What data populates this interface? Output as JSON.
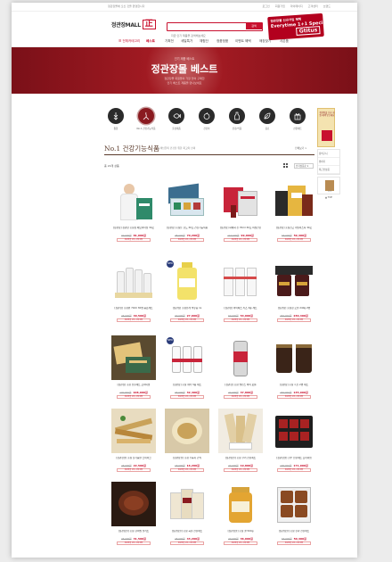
{
  "topbar": {
    "left_text": "정관장몰에 오신 것을 환영합니다",
    "links": [
      "로그인",
      "회원가입",
      "마이페이지",
      "고객센터",
      "브랜드"
    ]
  },
  "header": {
    "logo_text": "정관장MALL",
    "logo_mark": "正",
    "search_placeholder": "지금 인기 제품을 검색해보세요",
    "search_button": "검색",
    "promo_line1": "정관장몰 신규가입 혜택",
    "promo_line2": "Everytime 1+1 Special",
    "promo_badge": "Gtitus"
  },
  "nav": {
    "items": [
      "☰ 전체카테고리",
      "베스트",
      "기획전",
      "세일특가",
      "체험단",
      "정품정품",
      "이벤트 혜택",
      "매장찾기",
      "사은품"
    ]
  },
  "hero": {
    "pre_title": "인기 제품 베스트",
    "title": "정관장몰 베스트",
    "sub1": "정관장몰 회원들이 가장 많이 구매한",
    "sub2": "인기 베스트 제품을 만나보세요"
  },
  "categories": [
    {
      "label": "종합",
      "icon": "ginseng-icon",
      "active": false
    },
    {
      "label": "No.1 건강기능식품",
      "icon": "ginseng-root-icon",
      "active": true
    },
    {
      "label": "홍삼제품",
      "icon": "fish-icon",
      "active": false
    },
    {
      "label": "건강차",
      "icon": "apple-icon",
      "active": false
    },
    {
      "label": "건강/식품",
      "icon": "bottle-icon",
      "active": false
    },
    {
      "label": "음료",
      "icon": "leaf-icon",
      "active": false
    },
    {
      "label": "선물세트",
      "icon": "gift-icon",
      "active": false
    }
  ],
  "side": {
    "ad_text": "정관장몰 신규 회원 혜택 받으세요",
    "links": [
      "장바구니",
      "찜하기",
      "최근본상품"
    ],
    "recent_page": "1/1",
    "top_label": "▲ TOP"
  },
  "section": {
    "title": "No.1 건강기능식품",
    "description": "고객님들의 건강을 위한 최고의 선택",
    "more": "전체보기 >",
    "count_label": "총 20개 상품",
    "sort_label": "인기상품순 ▾"
  },
  "products": [
    {
      "name": "[정관장] 정관장 홍삼정 에브리타임 30포",
      "orig": "90,000원",
      "price": "81,000원",
      "tag": "정관장몰 단독 구매 혜택",
      "badge": ""
    },
    {
      "name": "[정관장] 홍삼톤 골드 30포 건강기능식품",
      "orig": "78,000원",
      "price": "70,200원",
      "tag": "정관장몰 단독 구매 혜택",
      "badge": ""
    },
    {
      "name": "[정관장] 화애락 진 70ml 30포 여성건강",
      "orig": "110,000원",
      "price": "99,000원",
      "tag": "정관장몰 단독 구매 혜택",
      "badge": ""
    },
    {
      "name": "[정관장] 홍삼진고 데일리스틱 30포",
      "orig": "66,000원",
      "price": "59,400원",
      "tag": "정관장몰 단독 구매 혜택",
      "badge": ""
    },
    {
      "name": "[정관장] 홍삼원 70ml 30병 음료세트",
      "orig": "45,000원",
      "price": "40,500원",
      "tag": "정관장몰 단독 구매 혜택",
      "badge": ""
    },
    {
      "name": "[정관장] 홍삼유래 석류즙 1L",
      "orig": "30,000원",
      "price": "27,000원",
      "tag": "정관장몰 단독 구매 혜택",
      "badge": "NEW"
    },
    {
      "name": "[정관장] 아이패스 키즈 3종 세트",
      "orig": "60,000원",
      "price": "54,000원",
      "tag": "정관장몰 단독 구매 혜택",
      "badge": ""
    },
    {
      "name": "[정관장] 홍삼정 로얄 240g 2병",
      "orig": "256,000원",
      "price": "230,400원",
      "tag": "정관장몰 단독 구매 혜택",
      "badge": ""
    },
    {
      "name": "[정관장] 홍삼 선물세트 프리미엄",
      "orig": "120,000원",
      "price": "108,000원",
      "tag": "정관장몰 단독 구매 혜택",
      "badge": ""
    },
    {
      "name": "[정관장] 홍삼 워터 3종 세트",
      "orig": "36,000원",
      "price": "32,400원",
      "tag": "정관장몰 단독 구매 혜택",
      "badge": "NEW"
    },
    {
      "name": "[정관장] 홍삼 밸런스 하이 보틀",
      "orig": "42,000원",
      "price": "37,800원",
      "tag": "정관장몰 단독 구매 혜택",
      "badge": ""
    },
    {
      "name": "[정관장] 홍삼 흑진 2병 세트",
      "orig": "150,000원",
      "price": "135,000원",
      "tag": "정관장몰 단독 구매 혜택",
      "badge": ""
    },
    {
      "name": "[정관장몰] 홍삼 닭가슴살 스테이크",
      "orig": "25,000원",
      "price": "22,500원",
      "tag": "정관장몰 단독 구매 혜택",
      "badge": ""
    },
    {
      "name": "[정관장몰] 홍삼 누룽지 간식",
      "orig": "18,000원",
      "price": "16,200원",
      "tag": "정관장몰 단독 구매 혜택",
      "badge": ""
    },
    {
      "name": "[정관장몰] 홍삼 쿠키 선물세트",
      "orig": "22,000원",
      "price": "19,800원",
      "tag": "정관장몰 단독 구매 혜택",
      "badge": ""
    },
    {
      "name": "[정관장몰] 한우 선물세트 프리미엄",
      "orig": "190,000원",
      "price": "171,000원",
      "tag": "정관장몰 단독 구매 혜택",
      "badge": ""
    },
    {
      "name": "[정관장몰] 홍삼 갈비찜 밀키트",
      "orig": "35,000원",
      "price": "31,500원",
      "tag": "정관장몰 단독 구매 혜택",
      "badge": ""
    },
    {
      "name": "[정관장몰] 홍삼 곡물 선물세트",
      "orig": "48,000원",
      "price": "43,200원",
      "tag": "정관장몰 단독 구매 혜택",
      "badge": ""
    },
    {
      "name": "[정관장몰] 홍삼 꿀 500g",
      "orig": "40,000원",
      "price": "36,000원",
      "tag": "정관장몰 단독 구매 혜택",
      "badge": ""
    },
    {
      "name": "[정관장몰] 홍삼 한과 선물세트",
      "orig": "56,000원",
      "price": "50,400원",
      "tag": "정관장몰 단독 구매 혜택",
      "badge": ""
    }
  ]
}
